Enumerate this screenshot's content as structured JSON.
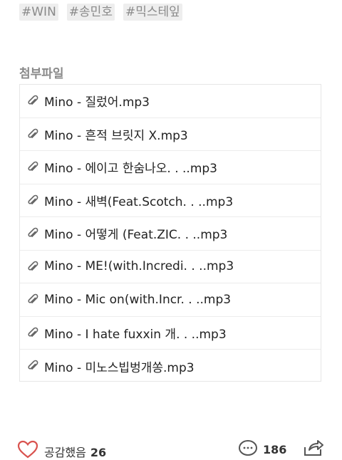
{
  "tags": [
    "#WIN",
    "#송민호",
    "#믹스테잎"
  ],
  "attachments": {
    "title": "첨부파일",
    "files": [
      "Mino - 질렀어.mp3",
      "Mino - 흔적 브릿지 X.mp3",
      "Mino - 에이고 한숨나오. . ..mp3",
      "Mino - 새벽(Feat.Scotch. . ..mp3",
      "Mino - 어떻게 (Feat.ZIC. . ..mp3",
      "Mino - ME!(with.Incredi. . ..mp3",
      "Mino - Mic on(with.Incr. . ..mp3",
      "Mino - I hate fuxxin 개. . ..mp3",
      "Mino - 미노스빕벙개쏭.mp3"
    ]
  },
  "footer": {
    "like_label": "공감했음",
    "like_count": "26",
    "comment_count": "186"
  },
  "icons": {
    "attachment": "paperclip-icon",
    "like": "heart-icon",
    "comment": "comment-icon",
    "share": "share-icon"
  },
  "colors": {
    "tag_bg": "#eeeeee",
    "muted_text": "#8a8a8a",
    "heart": "#d9534f"
  }
}
